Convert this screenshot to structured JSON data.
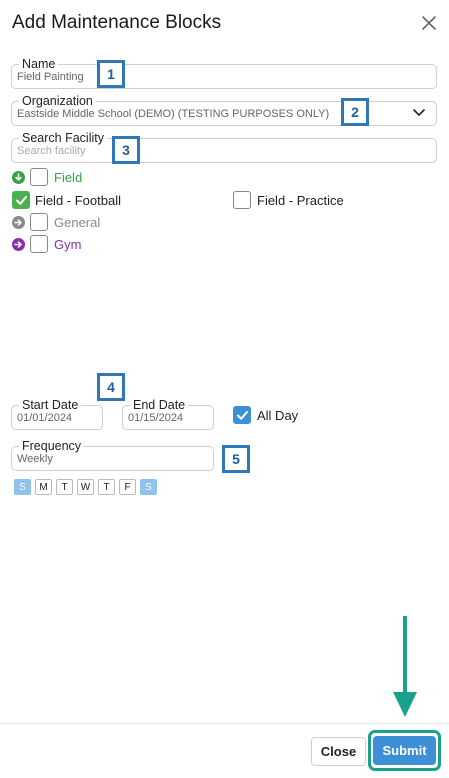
{
  "dialog": {
    "title": "Add Maintenance Blocks"
  },
  "form": {
    "name": {
      "label": "Name",
      "value": "Field Painting"
    },
    "organization": {
      "label": "Organization",
      "value": "Eastside Middle School (DEMO) (TESTING PURPOSES ONLY)"
    },
    "search_facility": {
      "label": "Search Facility",
      "placeholder": "Search facility"
    },
    "start_date": {
      "label": "Start Date",
      "value": "01/01/2024"
    },
    "end_date": {
      "label": "End Date",
      "value": "01/15/2024"
    },
    "all_day": {
      "label": "All Day",
      "checked": true
    },
    "frequency": {
      "label": "Frequency",
      "value": "Weekly"
    }
  },
  "facilities": [
    {
      "label": "Field",
      "color": "#3aa046",
      "checked": false,
      "expand_icon": "arrow-down-circle-icon"
    },
    {
      "label": "Field - Football",
      "color": "#222222",
      "checked": true
    },
    {
      "label": "Field - Practice",
      "color": "#222222",
      "checked": false
    },
    {
      "label": "General",
      "color": "#888888",
      "checked": false,
      "expand_icon": "arrow-right-circle-icon"
    },
    {
      "label": "Gym",
      "color": "#8b2fa8",
      "checked": false,
      "expand_icon": "arrow-right-circle-icon"
    }
  ],
  "weekdays": [
    {
      "label": "S",
      "selected": true
    },
    {
      "label": "M",
      "selected": false
    },
    {
      "label": "T",
      "selected": false
    },
    {
      "label": "W",
      "selected": false
    },
    {
      "label": "T",
      "selected": false
    },
    {
      "label": "F",
      "selected": false
    },
    {
      "label": "S",
      "selected": true
    }
  ],
  "annotations": [
    "1",
    "2",
    "3",
    "4",
    "5"
  ],
  "footer": {
    "close_label": "Close",
    "submit_label": "Submit"
  },
  "colors": {
    "accent": "#3d8fd6",
    "annotation_border": "#2f77b9",
    "highlight": "#19a18b",
    "check_green": "#4caf50"
  }
}
